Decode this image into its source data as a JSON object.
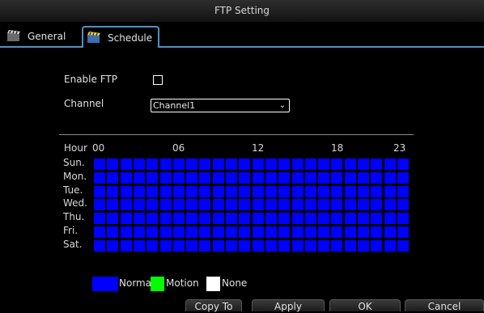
{
  "window": {
    "title": "FTP Setting"
  },
  "tabs": [
    {
      "label": "General",
      "icon": "film-clapper-icon"
    },
    {
      "label": "Schedule",
      "icon": "schedule-clapper-icon"
    }
  ],
  "form": {
    "enable_label": "Enable FTP",
    "enable_checked": false,
    "channel_label": "Channel",
    "channel_value": "Channel1"
  },
  "schedule": {
    "hour_label": "Hour",
    "hour_ticks": [
      "00",
      "06",
      "12",
      "18",
      "23"
    ],
    "days": [
      "Sun.",
      "Mon.",
      "Tue.",
      "Wed.",
      "Thu.",
      "Fri.",
      "Sat."
    ],
    "hours_per_day": 24,
    "all_cells_mode": "Normal"
  },
  "legend": [
    {
      "label": "Normal",
      "color": "#0000ff"
    },
    {
      "label": "Motion",
      "color": "#00ff00"
    },
    {
      "label": "None",
      "color": "#ffffff"
    }
  ],
  "buttons": {
    "copy_to": "Copy To",
    "apply": "Apply",
    "ok": "OK",
    "cancel": "Cancel"
  },
  "colors": {
    "accent": "#4a93c6",
    "normal": "#0000ff"
  }
}
